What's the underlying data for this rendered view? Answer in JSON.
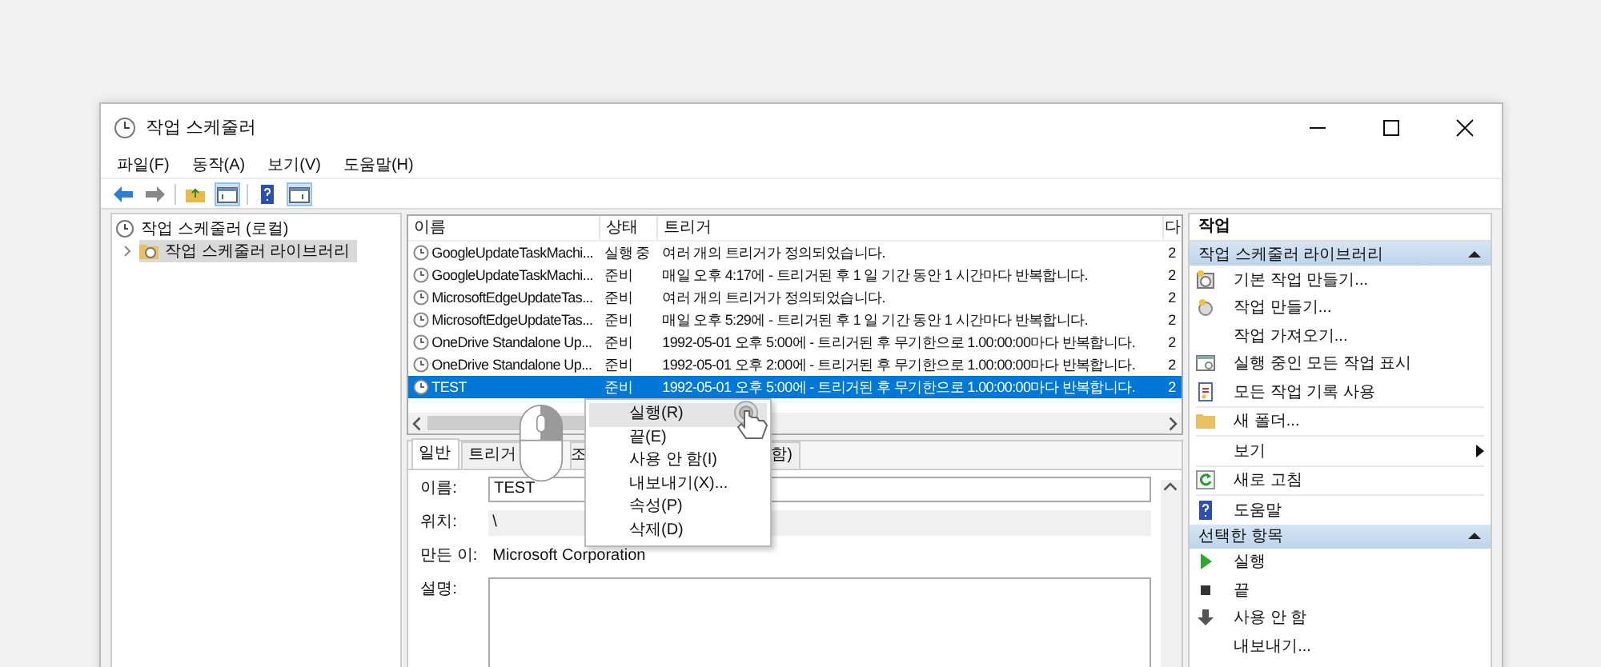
{
  "window": {
    "title": "작업 스케줄러"
  },
  "menu": [
    "파일(F)",
    "동작(A)",
    "보기(V)",
    "도움말(H)"
  ],
  "tree": [
    {
      "label": "작업 스케줄러 (로컬)",
      "selected": false,
      "children": [
        {
          "label": "작업 스케줄러 라이브러리",
          "selected": true,
          "expanded": false
        }
      ]
    }
  ],
  "tasks": {
    "columns": [
      "이름",
      "상태",
      "트리거",
      "다"
    ],
    "rows": [
      {
        "name": "GoogleUpdateTaskMachi...",
        "status": "실행 중",
        "trigger": "여러 개의 트리거가 정의되었습니다.",
        "column_4": "2",
        "selected": false
      },
      {
        "name": "GoogleUpdateTaskMachi...",
        "status": "준비",
        "trigger": "매일 오후 4:17에 - 트리거된 후 1 일 기간 동안 1 시간마다 반복합니다.",
        "column_4": "2",
        "selected": false
      },
      {
        "name": "MicrosoftEdgeUpdateTas...",
        "status": "준비",
        "trigger": "여러 개의 트리거가 정의되었습니다.",
        "column_4": "2",
        "selected": false
      },
      {
        "name": "MicrosoftEdgeUpdateTas...",
        "status": "준비",
        "trigger": "매일 오후 5:29에 - 트리거된 후 1 일 기간 동안 1 시간마다 반복합니다.",
        "column_4": "2",
        "selected": false
      },
      {
        "name": "OneDrive Standalone Up...",
        "status": "준비",
        "trigger": "1992-05-01 오후 5:00에 - 트리거된 후 무기한으로 1.00:00:00마다 반복합니다.",
        "column_4": "2",
        "selected": false
      },
      {
        "name": "OneDrive Standalone Up...",
        "status": "준비",
        "trigger": "1992-05-01 오후 2:00에 - 트리거된 후 무기한으로 1.00:00:00마다 반복합니다.",
        "column_4": "2",
        "selected": false
      },
      {
        "name": "TEST",
        "status": "준비",
        "trigger": "1992-05-01 오후 5:00에 - 트리거된 후 무기한으로 1.00:00:00마다 반복합니다.",
        "column_4": "2",
        "selected": true
      }
    ]
  },
  "context_menu": [
    {
      "label": "실행(R)",
      "selected": true
    },
    {
      "label": "끝(E)",
      "selected": false
    },
    {
      "label": "사용 안 함(I)",
      "selected": false
    },
    {
      "label": "내보내기(X)...",
      "selected": false
    },
    {
      "label": "속성(P)",
      "selected": false
    },
    {
      "label": "삭제(D)",
      "selected": false
    }
  ],
  "tabs": [
    {
      "label": "일반",
      "selected": true
    },
    {
      "label": "트리거",
      "selected": false
    },
    {
      "label": "조",
      "selected": false
    },
    {
      "label": "함)",
      "selected": false
    }
  ],
  "details": [
    {
      "label": "이름:",
      "value": "TEST",
      "kind": "input"
    },
    {
      "label": "위치:",
      "value": "\\",
      "kind": "readonly"
    },
    {
      "label": "만든 이:",
      "value": "Microsoft Corporation",
      "kind": "text"
    },
    {
      "label": "설명:",
      "kind": "textarea"
    }
  ],
  "actions": {
    "title": "작업",
    "sections": [
      {
        "title": "작업 스케줄러 라이브러리",
        "expanded": true,
        "items": [
          {
            "label": "기본 작업 만들기...",
            "kind": "wizard",
            "group_end": false
          },
          {
            "label": "작업 만들기...",
            "kind": "task",
            "group_end": false
          },
          {
            "label": "작업 가져오기...",
            "kind": "none",
            "group_end": false
          },
          {
            "label": "실행 중인 모든 작업 표시",
            "kind": "list",
            "group_end": false
          },
          {
            "label": "모든 작업 기록 사용",
            "kind": "history",
            "group_end": true
          },
          {
            "label": "새 폴더...",
            "kind": "folder",
            "group_end": true
          },
          {
            "label": "보기",
            "kind": "submenu",
            "group_end": true
          },
          {
            "label": "새로 고침",
            "kind": "refresh",
            "group_end": true
          },
          {
            "label": "도움말",
            "kind": "help",
            "group_end": false
          }
        ]
      },
      {
        "title": "선택한 항목",
        "expanded": true,
        "items": [
          {
            "label": "실행",
            "kind": "run",
            "group_end": false
          },
          {
            "label": "끝",
            "kind": "stop",
            "group_end": false
          },
          {
            "label": "사용 안 함",
            "kind": "disable",
            "group_end": false
          },
          {
            "label": "내보내기...",
            "kind": "none",
            "group_end": false
          }
        ]
      }
    ]
  }
}
